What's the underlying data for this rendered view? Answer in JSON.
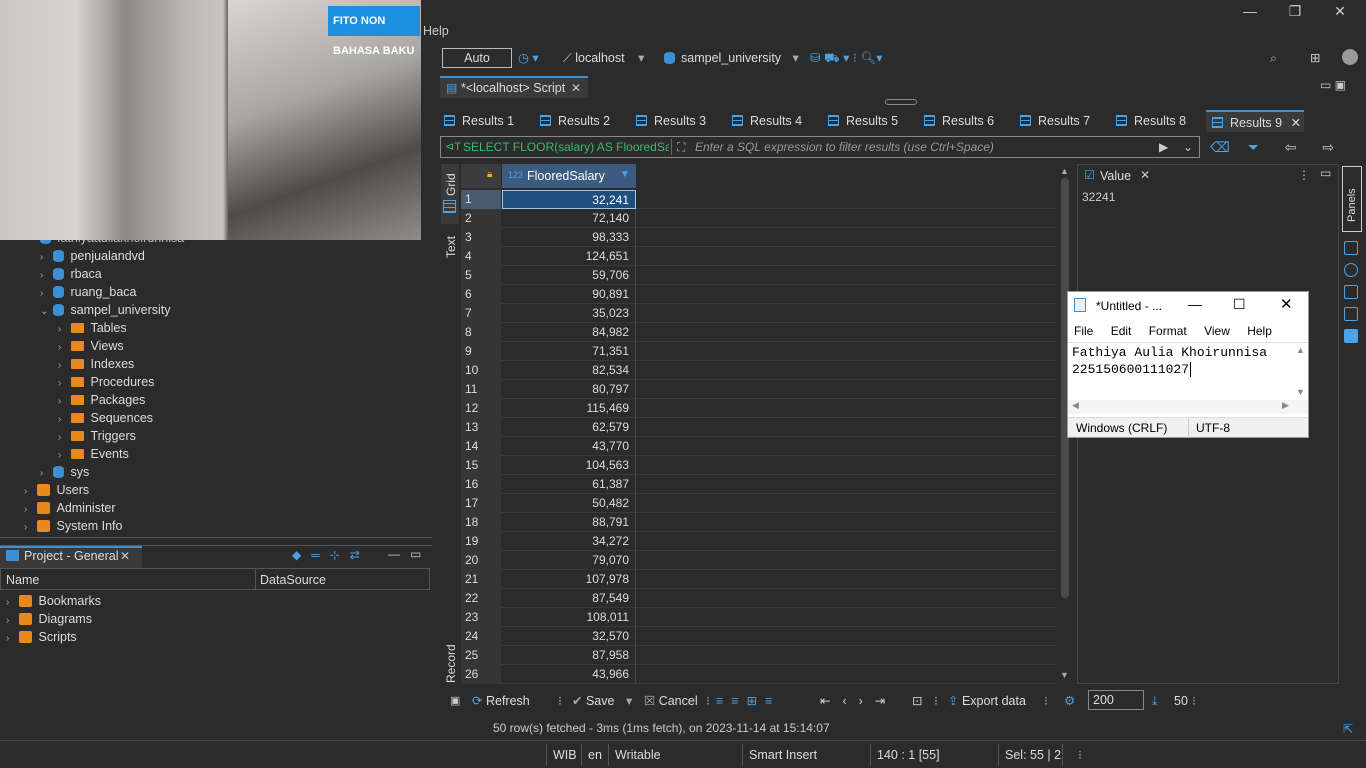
{
  "menu": {
    "help": "Help"
  },
  "toolbar": {
    "mode": "Auto",
    "connection": "localhost",
    "database": "sampel_university"
  },
  "video": {
    "logo_text": "FITO NON BAHASA BAKU"
  },
  "tree": {
    "partial_item": "fathiyaauliakhoirunnisa",
    "items": [
      {
        "label": "penjualandvd"
      },
      {
        "label": "rbaca"
      },
      {
        "label": "ruang_baca"
      },
      {
        "label": "sampel_university"
      }
    ],
    "children": [
      {
        "label": "Tables"
      },
      {
        "label": "Views"
      },
      {
        "label": "Indexes"
      },
      {
        "label": "Procedures"
      },
      {
        "label": "Packages"
      },
      {
        "label": "Sequences"
      },
      {
        "label": "Triggers"
      },
      {
        "label": "Events"
      }
    ],
    "sys": "sys",
    "users": "Users",
    "administer": "Administer",
    "system_info": "System Info"
  },
  "project": {
    "title": "Project - General",
    "col_name": "Name",
    "col_datasource": "DataSource",
    "items": [
      {
        "label": "Bookmarks"
      },
      {
        "label": "Diagrams"
      },
      {
        "label": "Scripts"
      }
    ]
  },
  "editor": {
    "tab_label": "*<localhost> Script"
  },
  "results_tabs": [
    {
      "label": "Results 1"
    },
    {
      "label": "Results 2"
    },
    {
      "label": "Results 3"
    },
    {
      "label": "Results 4"
    },
    {
      "label": "Results 5"
    },
    {
      "label": "Results 6"
    },
    {
      "label": "Results 7"
    },
    {
      "label": "Results 8"
    },
    {
      "label": "Results 9"
    }
  ],
  "filter": {
    "query": "SELECT FLOOR(salary) AS FlooredSalary",
    "placeholder": "Enter a SQL expression to filter results (use Ctrl+Space)"
  },
  "side_tabs": {
    "grid": "Grid",
    "text": "Text",
    "record": "Record",
    "panels": "Panels"
  },
  "grid": {
    "column": "FlooredSalary",
    "col_type": "123",
    "rows": [
      {
        "n": "1",
        "v": "32,241"
      },
      {
        "n": "2",
        "v": "72,140"
      },
      {
        "n": "3",
        "v": "98,333"
      },
      {
        "n": "4",
        "v": "124,651"
      },
      {
        "n": "5",
        "v": "59,706"
      },
      {
        "n": "6",
        "v": "90,891"
      },
      {
        "n": "7",
        "v": "35,023"
      },
      {
        "n": "8",
        "v": "84,982"
      },
      {
        "n": "9",
        "v": "71,351"
      },
      {
        "n": "10",
        "v": "82,534"
      },
      {
        "n": "11",
        "v": "80,797"
      },
      {
        "n": "12",
        "v": "115,469"
      },
      {
        "n": "13",
        "v": "62,579"
      },
      {
        "n": "14",
        "v": "43,770"
      },
      {
        "n": "15",
        "v": "104,563"
      },
      {
        "n": "16",
        "v": "61,387"
      },
      {
        "n": "17",
        "v": "50,482"
      },
      {
        "n": "18",
        "v": "88,791"
      },
      {
        "n": "19",
        "v": "34,272"
      },
      {
        "n": "20",
        "v": "79,070"
      },
      {
        "n": "21",
        "v": "107,978"
      },
      {
        "n": "22",
        "v": "87,549"
      },
      {
        "n": "23",
        "v": "108,011"
      },
      {
        "n": "24",
        "v": "32,570"
      },
      {
        "n": "25",
        "v": "87,958"
      },
      {
        "n": "26",
        "v": "43,966"
      }
    ]
  },
  "value_panel": {
    "title": "Value",
    "value": "32241"
  },
  "notepad": {
    "title": "*Untitled - ...",
    "menu": [
      "File",
      "Edit",
      "Format",
      "View",
      "Help"
    ],
    "line1": "Fathiya Aulia Khoirunnisa",
    "line2": "225150600111027",
    "encoding_line": "Windows (CRLF)",
    "charset": "UTF-8"
  },
  "bottom": {
    "refresh": "Refresh",
    "save": "Save",
    "cancel": "Cancel",
    "export": "Export data",
    "fetch_size": "200",
    "row_count": "50",
    "status": "50 row(s) fetched - 3ms (1ms fetch), on 2023-11-14 at 15:14:07"
  },
  "statusbar": {
    "tz": "WIB",
    "lang": "en",
    "mode": "Writable",
    "insert": "Smart Insert",
    "pos": "140 : 1 [55]",
    "sel": "Sel: 55 | 2"
  }
}
